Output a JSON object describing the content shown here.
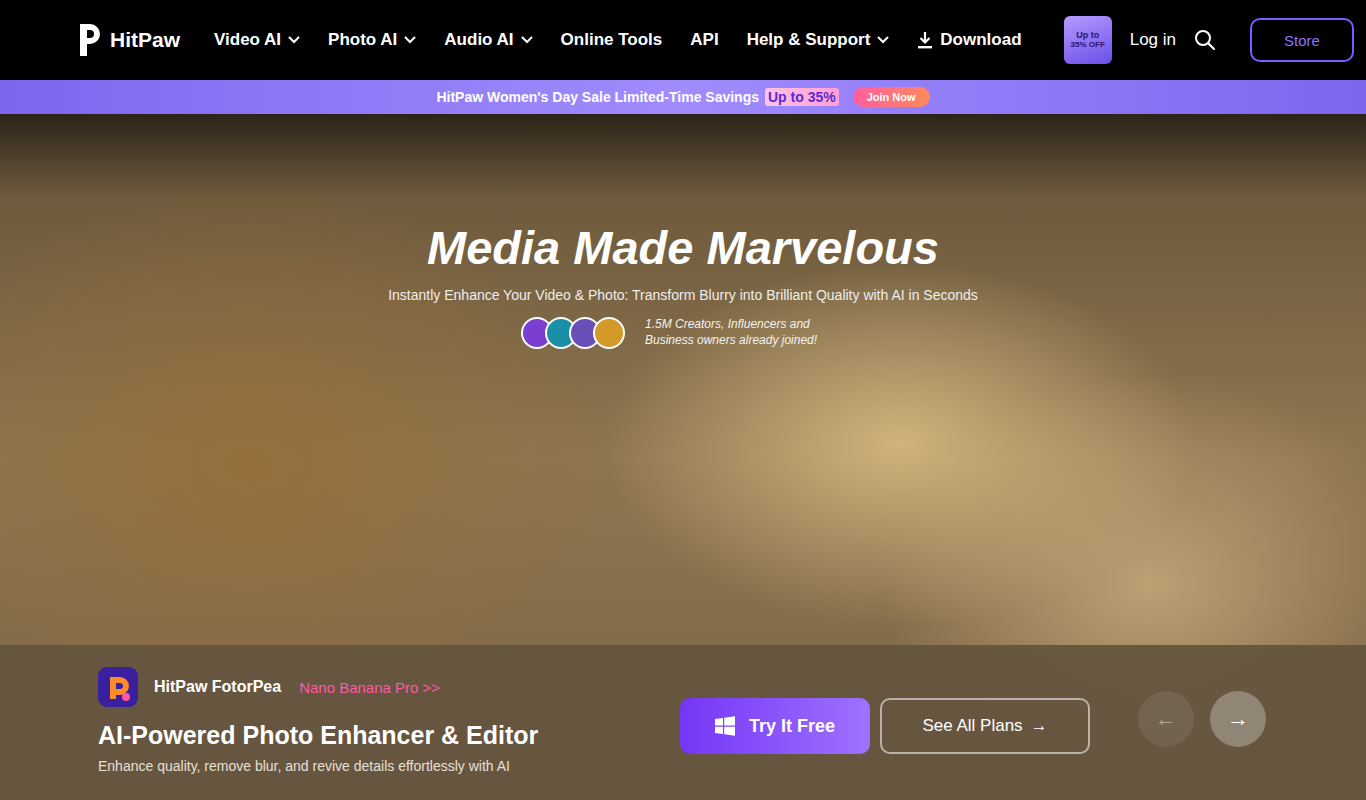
{
  "brand": {
    "name": "HitPaw"
  },
  "nav": {
    "items": [
      {
        "label": "Video AI",
        "dropdown": true
      },
      {
        "label": "Photo AI",
        "dropdown": true
      },
      {
        "label": "Audio AI",
        "dropdown": true
      },
      {
        "label": "Online Tools",
        "dropdown": false
      },
      {
        "label": "API",
        "dropdown": false
      },
      {
        "label": "Help & Support",
        "dropdown": true
      }
    ],
    "download": "Download",
    "promo_badge": {
      "line1": "Up to",
      "line2": "35% OFF"
    },
    "login": "Log in",
    "store": "Store"
  },
  "banner": {
    "text": "HitPaw Women's Day Sale Limited-Time Savings",
    "highlight": "Up to 35%",
    "button": "Join Now"
  },
  "hero": {
    "title": "Media Made Marvelous",
    "subtitle": "Instantly Enhance Your Video & Photo: Transform Blurry into Brilliant Quality with AI in Seconds",
    "social_proof": "1.5M Creators, Influencers and Business owners already joined!"
  },
  "product": {
    "name": "HitPaw FotorPea",
    "tag": "Nano Banana Pro >>",
    "headline": "AI-Powered Photo Enhancer & Editor",
    "description": "Enhance quality, remove blur, and revive details effortlessly with AI",
    "primary_button": "Try It Free",
    "secondary_button": {
      "label": "See All Plans",
      "arrow": "→"
    }
  },
  "carousel": {
    "controls": [
      {
        "glyph": "←",
        "disabled": true
      },
      {
        "glyph": "→",
        "disabled": false
      }
    ]
  }
}
